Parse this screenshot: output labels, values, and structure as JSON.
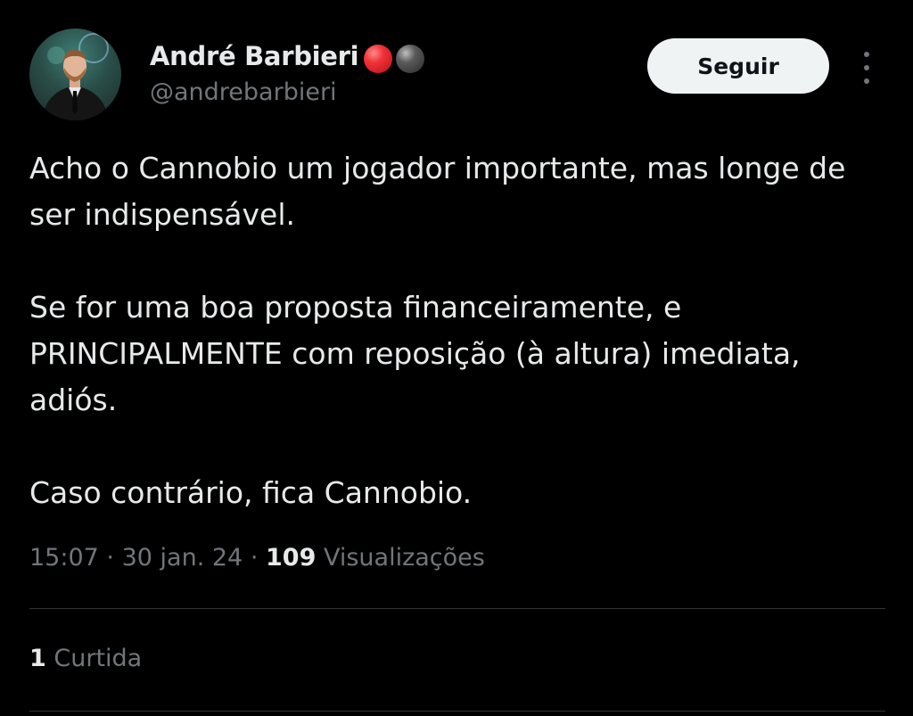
{
  "author": {
    "name": "André Barbieri",
    "handle": "@andrebarbieri",
    "badges": [
      "red-circle-icon",
      "black-circle-icon"
    ]
  },
  "actions": {
    "follow_label": "Seguir",
    "more_icon": "more-vertical-icon"
  },
  "tweet": {
    "paragraphs": [
      "Acho o Cannobio um jogador importante, mas longe de ser indispensável.",
      "Se for uma boa proposta financeiramente, e PRINCIPALMENTE com reposição (à altura) imediata, adiós.",
      "Caso contrário, fica Cannobio."
    ]
  },
  "meta": {
    "time": "15:07",
    "separator": "·",
    "date": "30 jan. 24",
    "views_count": "109",
    "views_label": "Visualizações"
  },
  "engagement": {
    "likes_count": "1",
    "likes_label": "Curtida"
  },
  "colors": {
    "background": "#000000",
    "text_primary": "#e7e9ea",
    "text_secondary": "#71767b",
    "button_bg": "#eff3f4",
    "divider": "#2f3336"
  }
}
